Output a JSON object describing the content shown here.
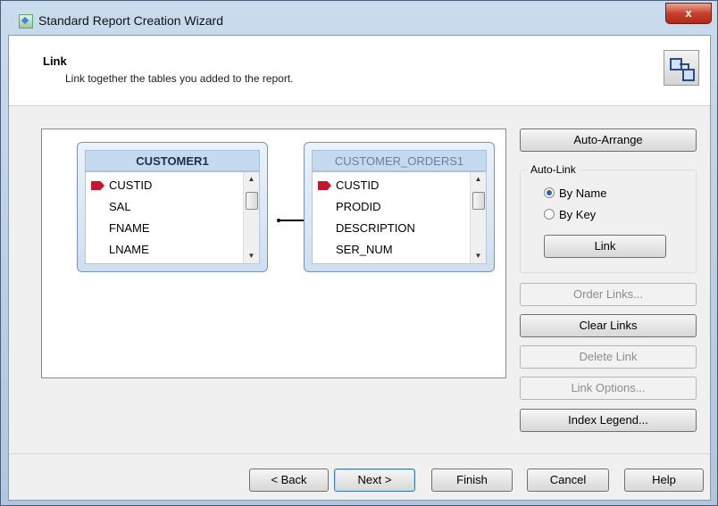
{
  "window": {
    "title": "Standard Report Creation Wizard",
    "close_label": "x"
  },
  "header": {
    "title": "Link",
    "subtitle": "Link together the tables you added to the report."
  },
  "tables": [
    {
      "name": "CUSTOMER1",
      "fields": [
        "CUSTID",
        "SAL",
        "FNAME",
        "LNAME"
      ]
    },
    {
      "name": "CUSTOMER_ORDERS1",
      "fields": [
        "CUSTID",
        "PRODID",
        "DESCRIPTION",
        "SER_NUM"
      ]
    }
  ],
  "side": {
    "auto_arrange": "Auto-Arrange",
    "auto_link": {
      "label": "Auto-Link",
      "by_name": "By Name",
      "by_key": "By Key",
      "selected": "By Name",
      "link": "Link"
    },
    "order_links": "Order Links...",
    "clear_links": "Clear Links",
    "delete_link": "Delete Link",
    "link_options": "Link Options...",
    "index_legend": "Index Legend..."
  },
  "footer": {
    "back": "< Back",
    "next": "Next >",
    "finish": "Finish",
    "cancel": "Cancel",
    "help": "Help"
  },
  "colors": {
    "key_marker": "#c4162c",
    "accent": "#2a62b5"
  }
}
